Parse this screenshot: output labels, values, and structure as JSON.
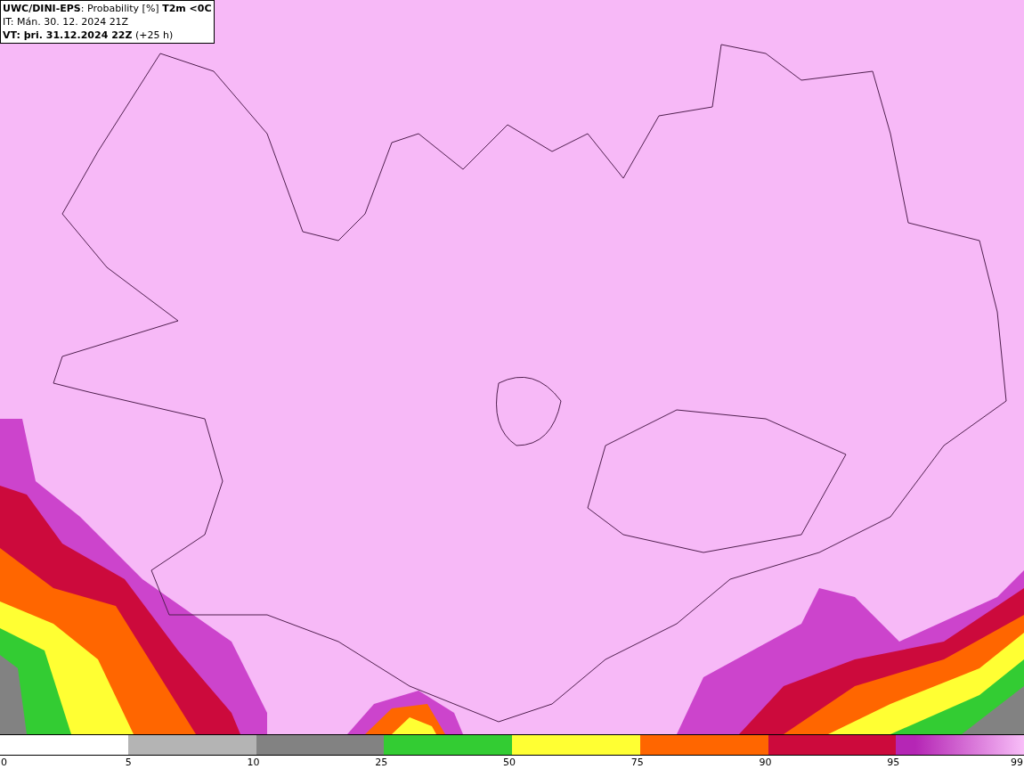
{
  "header": {
    "lines": [
      "**UWC/DINI-EPS**: Probability [%] **T2m <0C**",
      "IT: Mán. 30. 12. 2024 21Z",
      "**VT: þri. 31.12.2024 22Z** (+25 h)"
    ]
  },
  "legend": {
    "start_label": "0",
    "segments": [
      {
        "color": "#ffffff",
        "label": "5"
      },
      {
        "color": "#b4b4b4",
        "label": "10"
      },
      {
        "color": "#828282",
        "label": "25"
      },
      {
        "color": "#33cc33",
        "label": "50"
      },
      {
        "color": "#ffff33",
        "label": "75"
      },
      {
        "color": "#ff6600",
        "label": "90"
      },
      {
        "color": "#cc0a3c",
        "label": "95"
      },
      {
        "color": "#b526b5",
        "kind": "gradient",
        "label": "99"
      }
    ]
  }
}
